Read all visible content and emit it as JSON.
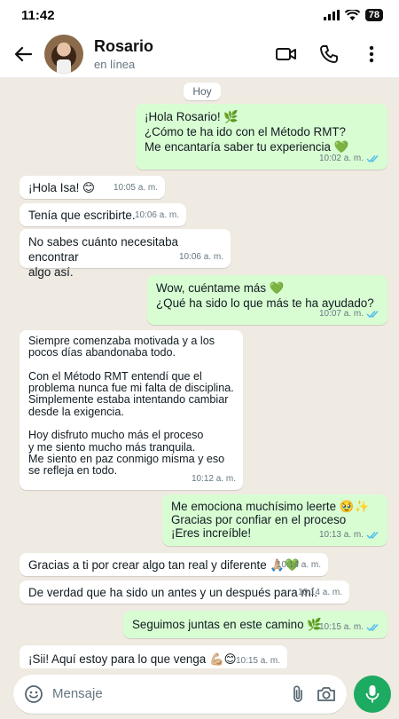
{
  "status_bar": {
    "time": "11:42",
    "battery": "78"
  },
  "header": {
    "contact_name": "Rosario",
    "contact_status": "en línea",
    "icons": [
      "back-arrow-icon",
      "video-call-icon",
      "phone-icon",
      "more-vert-icon"
    ]
  },
  "chat": {
    "day_label": "Hoy",
    "messages": [
      {
        "dir": "out",
        "text": "¡Hola Rosario! 🌿\n¿Cómo te ha ido con el Método RMT?\nMe encantaría saber tu experiencia 💚",
        "time": "10:02 a. m.",
        "read": true
      },
      {
        "dir": "in",
        "text": "¡Hola Isa! 😊",
        "time": "10:05 a. m."
      },
      {
        "dir": "in",
        "text": "Tenía que escribirte.",
        "time": "10:06 a. m."
      },
      {
        "dir": "in",
        "text": "No sabes cuánto necesitaba encontrar\nalgo así.",
        "time": "10:06 a. m."
      },
      {
        "dir": "out",
        "text": "Wow, cuéntame más 💚\n¿Qué ha sido lo que más te ha ayudado?",
        "time": "10:07 a. m.",
        "read": true
      },
      {
        "dir": "in",
        "text": "Siempre comenzaba motivada y a los\npocos días abandonaba todo.\n\nCon el Método RMT entendí que el\nproblema nunca fue mi falta de disciplina.\nSimplemente estaba intentando cambiar\ndesde la exigencia.\n\nHoy disfruto mucho más el proceso\ny me siento mucho más tranquila.\nMe siento en paz conmigo misma y eso\nse refleja en todo.",
        "time": "10:12 a. m."
      },
      {
        "dir": "out",
        "text": "Me emociona muchísimo leerte 🥹✨\nGracias por confiar en el proceso\n¡Eres increíble!",
        "time": "10:13 a. m.",
        "read": true
      },
      {
        "dir": "in",
        "text": "Gracias a ti por crear algo tan real y diferente 🙏🏼💚",
        "time": "10:14 a. m."
      },
      {
        "dir": "in",
        "text": "De verdad que ha sido un antes y un después para mí.",
        "time": "10:14 a. m."
      },
      {
        "dir": "out",
        "text": "Seguimos juntas en este camino 🌿",
        "time": "10:15 a. m.",
        "read": true
      },
      {
        "dir": "in",
        "text": "¡Sii! Aquí estoy para lo que venga 💪🏼😊",
        "time": "10:15 a. m."
      }
    ]
  },
  "composer": {
    "placeholder": "Mensaje",
    "icons": [
      "emoji-icon",
      "attach-icon",
      "camera-icon",
      "mic-icon"
    ]
  },
  "colors": {
    "chat_background": "#efeae2",
    "outgoing_bubble": "#d9fdd3",
    "incoming_bubble": "#ffffff",
    "read_ticks": "#53bdeb",
    "mic_button": "#1daa61"
  }
}
